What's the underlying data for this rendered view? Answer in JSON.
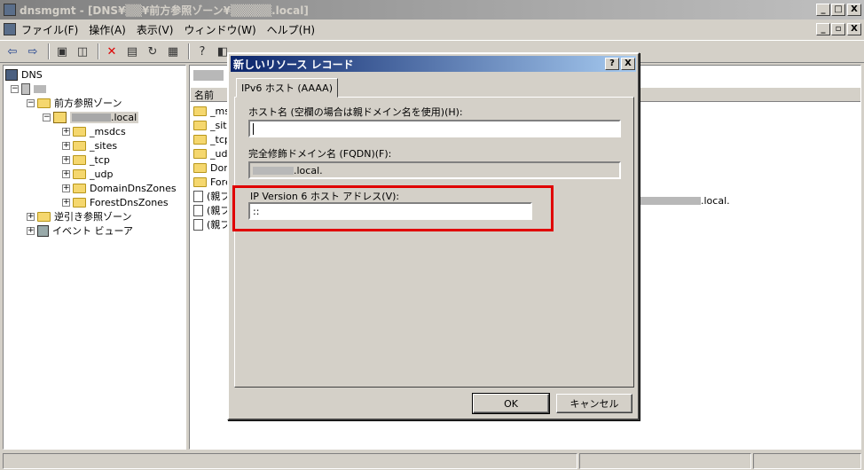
{
  "window": {
    "title": "dnsmgmt - [DNS¥▒▒¥前方参照ゾーン¥▒▒▒▒▒.local]",
    "controls": [
      "_",
      "□",
      "X"
    ]
  },
  "menu": {
    "items": [
      "ファイル(F)",
      "操作(A)",
      "表示(V)",
      "ウィンドウ(W)",
      "ヘルプ(H)"
    ],
    "mdi_controls": [
      "_",
      "▫",
      "X"
    ]
  },
  "tree": {
    "root": "DNS",
    "forward_zones": "前方参照ゾーン",
    "zone_suffix": ".local",
    "subfolders": [
      "_msdcs",
      "_sites",
      "_tcp",
      "_udp",
      "DomainDnsZones",
      "ForestDnsZones"
    ],
    "reverse_zones": "逆引き参照ゾーン",
    "event_viewer": "イベント ビューア"
  },
  "list": {
    "column_name": "名前",
    "items": [
      "_ms",
      "_site",
      "_tcp",
      "_udp",
      "Dom",
      "Fore",
      "(親フ",
      "(親フ",
      "(親フ"
    ],
    "right_value": ".local."
  },
  "dialog": {
    "title": "新しいリソース レコード",
    "help": "?",
    "close": "X",
    "tab": "IPv6 ホスト (AAAA)",
    "host_label": "ホスト名 (空欄の場合は親ドメイン名を使用)(H):",
    "host_value": "",
    "fqdn_label": "完全修飾ドメイン名 (FQDN)(F):",
    "fqdn_value": ".local.",
    "ip_label": "IP Version 6 ホスト アドレス(V):",
    "ip_value": "::",
    "ok": "OK",
    "cancel": "キャンセル"
  }
}
